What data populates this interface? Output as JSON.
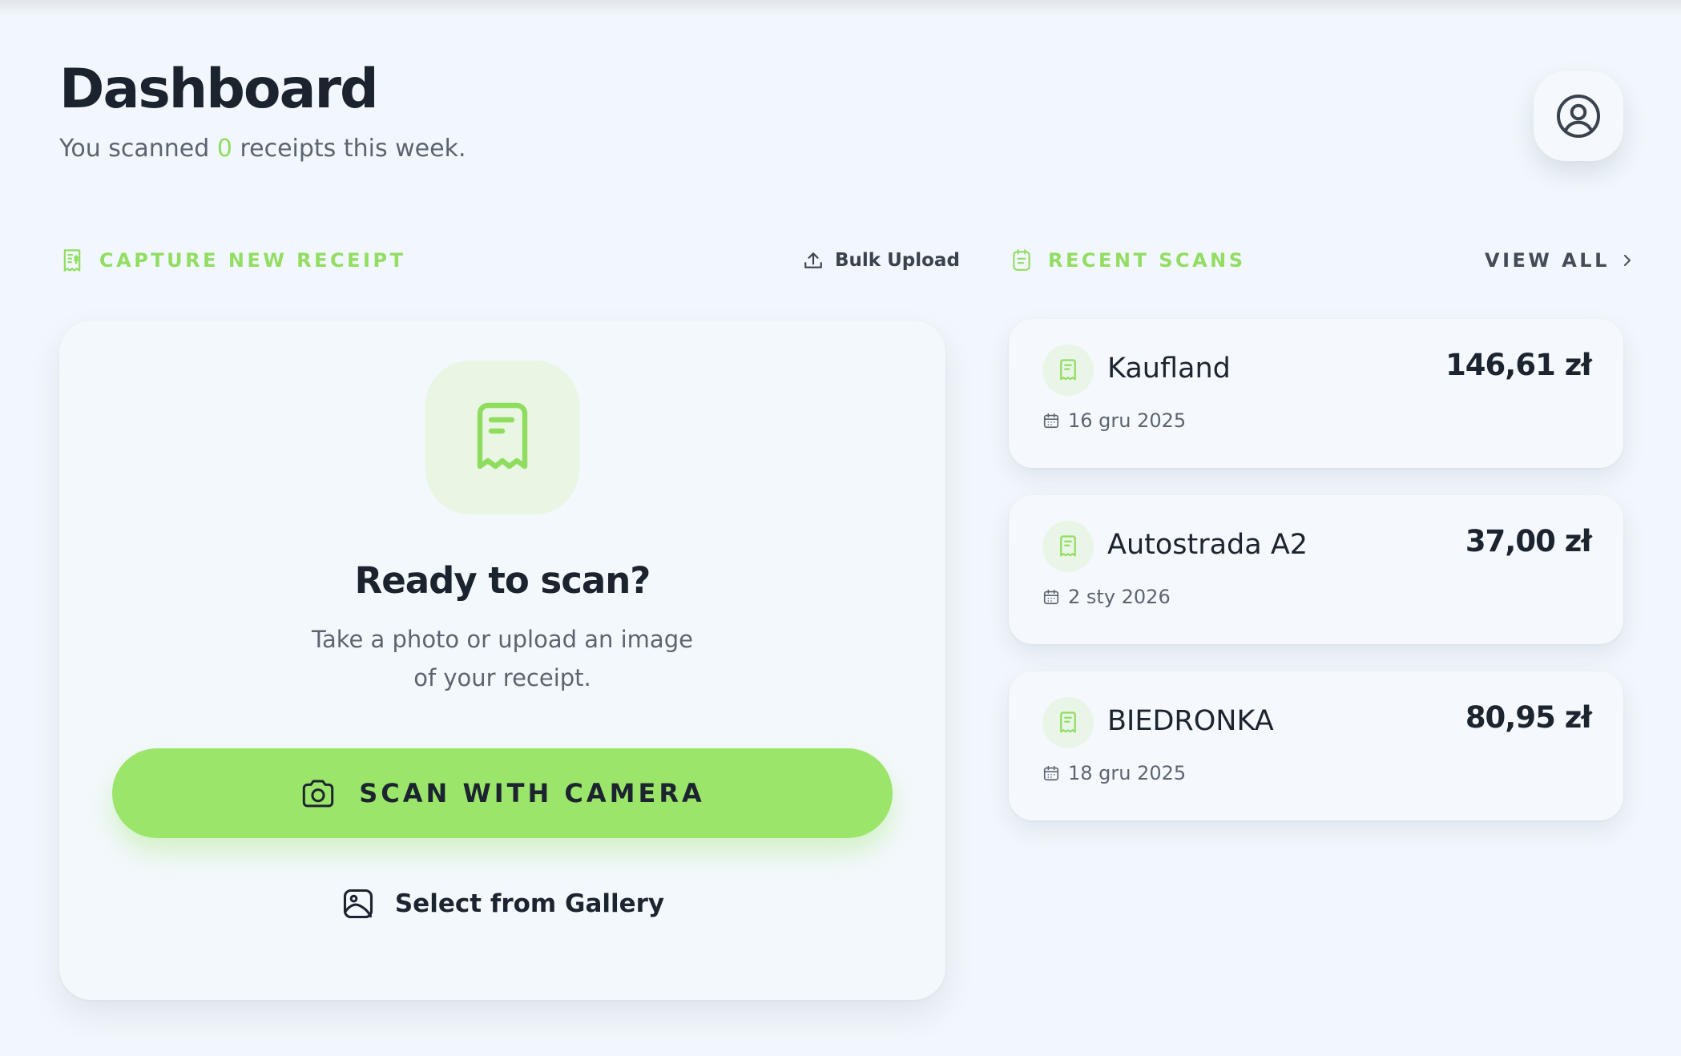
{
  "header": {
    "title": "Dashboard",
    "subtitle_prefix": "You scanned ",
    "subtitle_count": "0",
    "subtitle_suffix": " receipts this week.",
    "profile_icon": "user-circle-icon"
  },
  "capture": {
    "section_label": "CAPTURE NEW RECEIPT",
    "bulk_upload_label": "Bulk Upload",
    "heading": "Ready to scan?",
    "description_line1": "Take a photo or upload an image",
    "description_line2": "of your receipt.",
    "scan_button_label": "SCAN WITH CAMERA",
    "gallery_button_label": "Select from Gallery"
  },
  "recent": {
    "section_label": "RECENT SCANS",
    "view_all_label": "VIEW ALL",
    "items": [
      {
        "store": "Kaufland",
        "amount": "146,61 zł",
        "date": "16 gru 2025"
      },
      {
        "store": "Autostrada A2",
        "amount": "37,00 zł",
        "date": "2 sty 2026"
      },
      {
        "store": "BIEDRONKA",
        "amount": "80,95 zł",
        "date": "18 gru 2025"
      }
    ]
  },
  "colors": {
    "accent": "#9be56a",
    "accent_text": "#92dd62",
    "background": "#f1f7fc",
    "text_dark": "#1c2430",
    "text_muted": "#5c6470"
  }
}
